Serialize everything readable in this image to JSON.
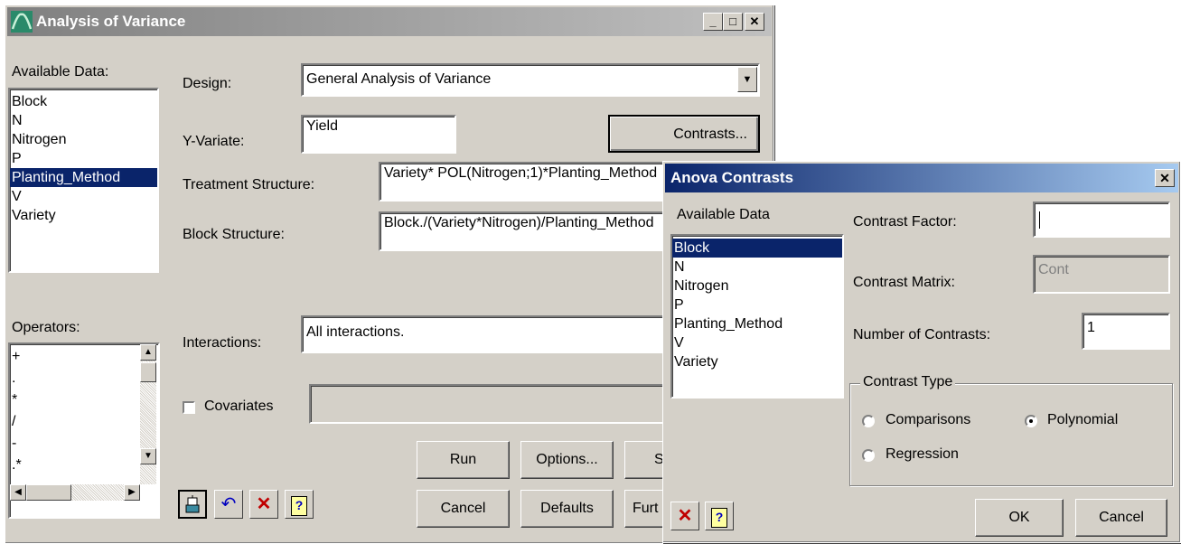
{
  "main_window": {
    "title": "Analysis of Varia",
    "title_suffix": "nce",
    "available_data_label": "Available Data:",
    "available_data": [
      "Block",
      "N",
      "Nitrogen",
      "P",
      "Planting_Method",
      "V",
      "Variety"
    ],
    "selected_available": "Planting_Method",
    "design_label": "Design:",
    "design_value": "General Analysis of Variance",
    "yvariate_label": "Y-Variate:",
    "yvariate_value": "Yield",
    "contrasts_button": "Contrasts...",
    "treatment_label": "Treatment Structure:",
    "treatment_value": "Variety* POL(Nitrogen;1)*Planting_Method",
    "block_label": "Block Structure:",
    "block_value": "Block./(Variety*Nitrogen)/Planting_Method",
    "operators_label": "Operators:",
    "operators": [
      "+",
      ".",
      "*",
      "/",
      "-",
      ".*"
    ],
    "interactions_label": "Interactions:",
    "interactions_value": "All interactions.",
    "covariates_label": "Covariates",
    "run_button": "Run",
    "options_button": "Options...",
    "save_button_partial": "S",
    "cancel_button": "Cancel",
    "defaults_button": "Defaults",
    "further_button_partial": "Furt"
  },
  "contrasts_dialog": {
    "title": "Anova Contrasts",
    "available_data_label": "Available Data",
    "available_data": [
      "Block",
      "N",
      "Nitrogen",
      "P",
      "Planting_Method",
      "V",
      "Variety"
    ],
    "selected_available": "Block",
    "contrast_factor_label": "Contrast Factor:",
    "contrast_factor_value": "",
    "contrast_matrix_label": "Contrast Matrix:",
    "contrast_matrix_value": "Cont",
    "num_contrasts_label": "Number of Contrasts:",
    "num_contrasts_value": "1",
    "contrast_type_label": "Contrast Type",
    "comparisons_label": "Comparisons",
    "polynomial_label": "Polynomial",
    "regression_label": "Regression",
    "selected_type": "Polynomial",
    "ok_button": "OK",
    "cancel_button": "Cancel"
  },
  "colors": {
    "face": "#d4d0c8",
    "selection": "#0a246a",
    "active_title": "#0a246a",
    "inactive_title": "#808080"
  }
}
